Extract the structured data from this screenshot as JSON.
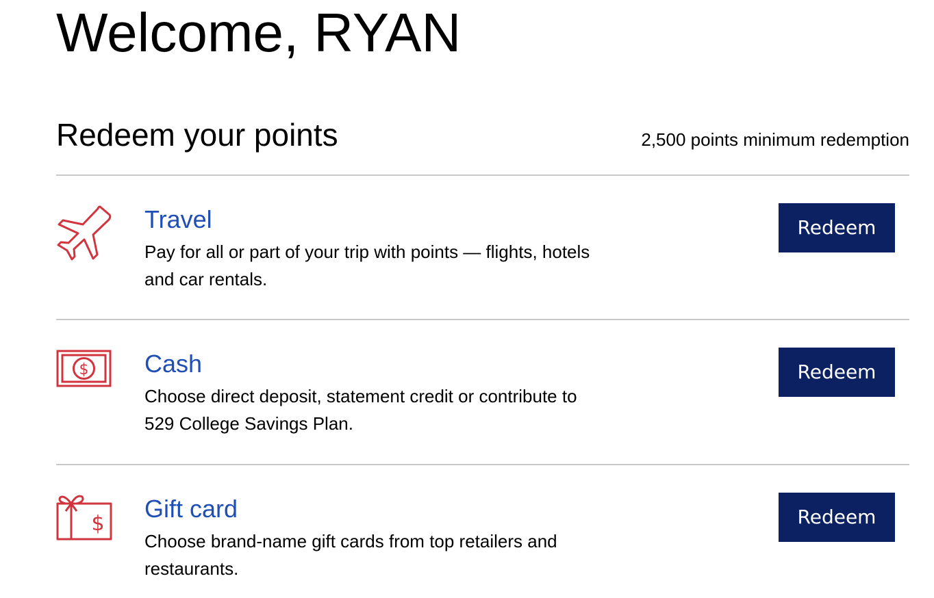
{
  "header": {
    "welcome": "Welcome, RYAN"
  },
  "redeem": {
    "title": "Redeem your points",
    "minimum_note": "2,500 points minimum redemption",
    "options": [
      {
        "title": "Travel",
        "description": "Pay for all or part of your trip with points — flights, hotels and car rentals.",
        "button_label": "Redeem",
        "icon": "airplane-icon"
      },
      {
        "title": "Cash",
        "description": "Choose direct deposit, statement credit or contribute to 529 College Savings Plan.",
        "button_label": "Redeem",
        "icon": "cash-bill-icon"
      },
      {
        "title": "Gift card",
        "description": "Choose brand-name gift cards from top retailers and restaurants.",
        "button_label": "Redeem",
        "icon": "gift-card-icon"
      }
    ]
  },
  "colors": {
    "link_blue": "#1f4fb5",
    "button_navy": "#0b2162",
    "icon_red": "#d0343f",
    "divider_gray": "#c8c8c8"
  }
}
